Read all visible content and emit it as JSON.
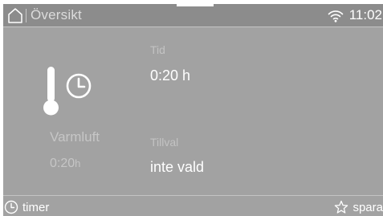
{
  "header": {
    "title": "Översikt",
    "time": "11:02",
    "home_icon": "home-icon",
    "wifi_icon": "wifi-icon"
  },
  "program": {
    "name": "Varmluft",
    "duration": "0:20",
    "duration_unit": "h",
    "icon": "thermometer-timer-icon"
  },
  "fields": {
    "tid_label": "Tid",
    "tid_value": "0:20 h",
    "tillval_label": "Tillval",
    "tillval_value": "inte vald"
  },
  "footer": {
    "timer_label": "timer",
    "timer_icon": "clock-icon",
    "spara_label": "spara",
    "spara_icon": "star-icon"
  },
  "colors": {
    "screen_bg": "#a2a2a2",
    "header_bg": "#8c8c8c",
    "text_primary": "#ffffff",
    "text_muted": "#c6c6c6"
  }
}
